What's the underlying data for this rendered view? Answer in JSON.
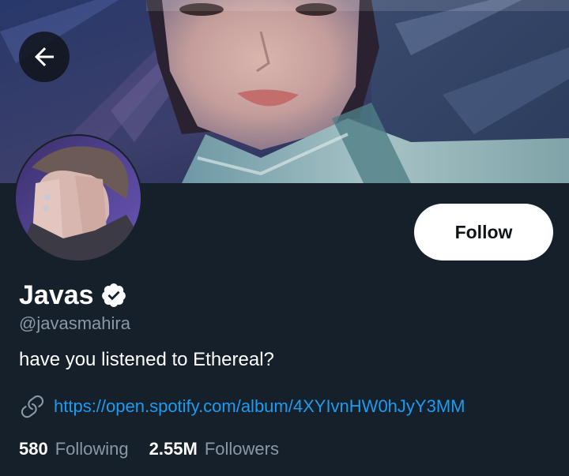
{
  "profile": {
    "display_name": "Javas",
    "handle": "@javasmahira",
    "bio": "have you listened to Ethereal?",
    "link": "https://open.spotify.com/album/4XYIvnHW0hJyY3MM",
    "follow_label": "Follow"
  },
  "stats": {
    "following_count": "580",
    "following_label": "Following",
    "followers_count": "2.55M",
    "followers_label": "Followers"
  },
  "icons": {
    "back": "arrow-left-icon",
    "verified": "verified-badge-icon",
    "link": "link-icon"
  },
  "colors": {
    "background": "#15202b",
    "accent": "#1d9bf0",
    "secondary_text": "#8b98a5",
    "follow_button": "#ffffff"
  }
}
